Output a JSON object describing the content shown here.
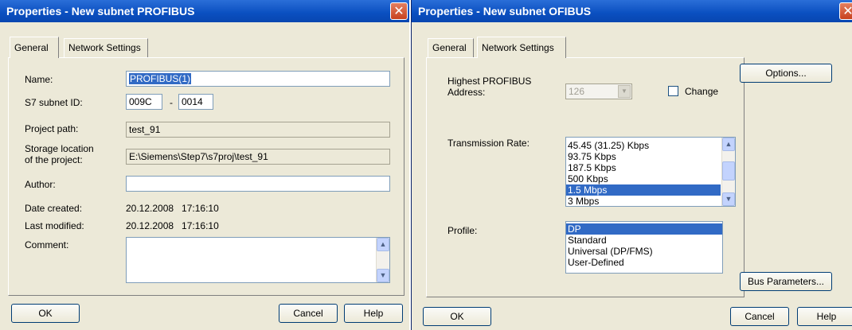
{
  "general_window": {
    "title": "Properties  -  New subnet PROFIBUS",
    "tabs": [
      "General",
      "Network Settings"
    ],
    "fields": {
      "name_label": "Name:",
      "name_value": "PROFIBUS(1)",
      "subnet_id_label": "S7 subnet ID:",
      "subnet_id_part1": "009C",
      "subnet_id_sep": "-",
      "subnet_id_part2": "0014",
      "project_path_label": "Project path:",
      "project_path_value": "test_91",
      "storage_label_line1": "Storage location",
      "storage_label_line2": "of the project:",
      "storage_value": "E:\\Siemens\\Step7\\s7proj\\test_91",
      "author_label": "Author:",
      "author_value": "",
      "date_created_label": "Date created:",
      "date_created_value": "20.12.2008   17:16:10",
      "last_modified_label": "Last modified:",
      "last_modified_value": "20.12.2008   17:16:10",
      "comment_label": "Comment:",
      "comment_value": ""
    },
    "buttons": {
      "ok": "OK",
      "cancel": "Cancel",
      "help": "Help"
    }
  },
  "network_window": {
    "title": "Properties  -  New subnet OFIBUS",
    "tabs": [
      "General",
      "Network Settings"
    ],
    "highest_address_label_line1": "Highest PROFIBUS",
    "highest_address_label_line2": "Address:",
    "highest_address_value": "126",
    "change_label": "Change",
    "transmission_rate_label": "Transmission Rate:",
    "transmission_rates": [
      "45.45 (31.25) Kbps",
      "93.75 Kbps",
      "187.5 Kbps",
      "500 Kbps",
      "1.5 Mbps",
      "3 Mbps"
    ],
    "selected_rate": "1.5 Mbps",
    "profile_label": "Profile:",
    "profiles": [
      "DP",
      "Standard",
      "Universal (DP/FMS)",
      "User-Defined"
    ],
    "selected_profile": "DP",
    "buttons": {
      "options": "Options...",
      "bus_parameters": "Bus Parameters...",
      "ok": "OK",
      "cancel": "Cancel",
      "help": "Help"
    }
  },
  "colors": {
    "title_bar": "#0a4fc0",
    "selection": "#316ac5",
    "dialog_face": "#ece9d8",
    "close_button": "#c8411e"
  }
}
